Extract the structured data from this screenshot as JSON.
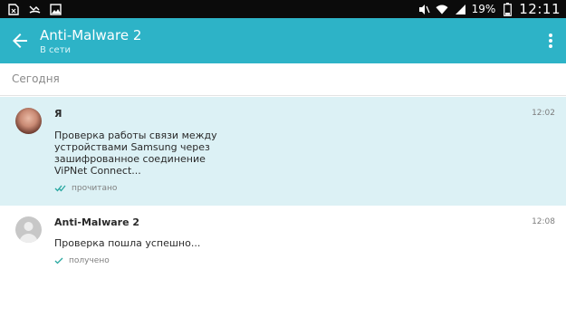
{
  "status_bar": {
    "battery_percent": "19%",
    "clock": "12:11",
    "icons": [
      "sim-card-icon",
      "missed-call-icon",
      "gallery-icon",
      "mute-icon",
      "wifi-icon",
      "signal-icon",
      "battery-icon"
    ]
  },
  "app_bar": {
    "title": "Anti-Malware 2",
    "subtitle": "В сети",
    "accent_color": "#2db3c7"
  },
  "date_header": "Сегодня",
  "messages": [
    {
      "sender": "Я",
      "time": "12:02",
      "text": "Проверка работы связи между устройствами Samsung через зашифрованное соединение ViPNet Connect...",
      "status": "прочитано",
      "status_icon": "double-check-icon"
    },
    {
      "sender": "Anti-Malware 2",
      "time": "12:08",
      "text": "Проверка пошла успешно...",
      "status": "получено",
      "status_icon": "check-icon"
    }
  ]
}
